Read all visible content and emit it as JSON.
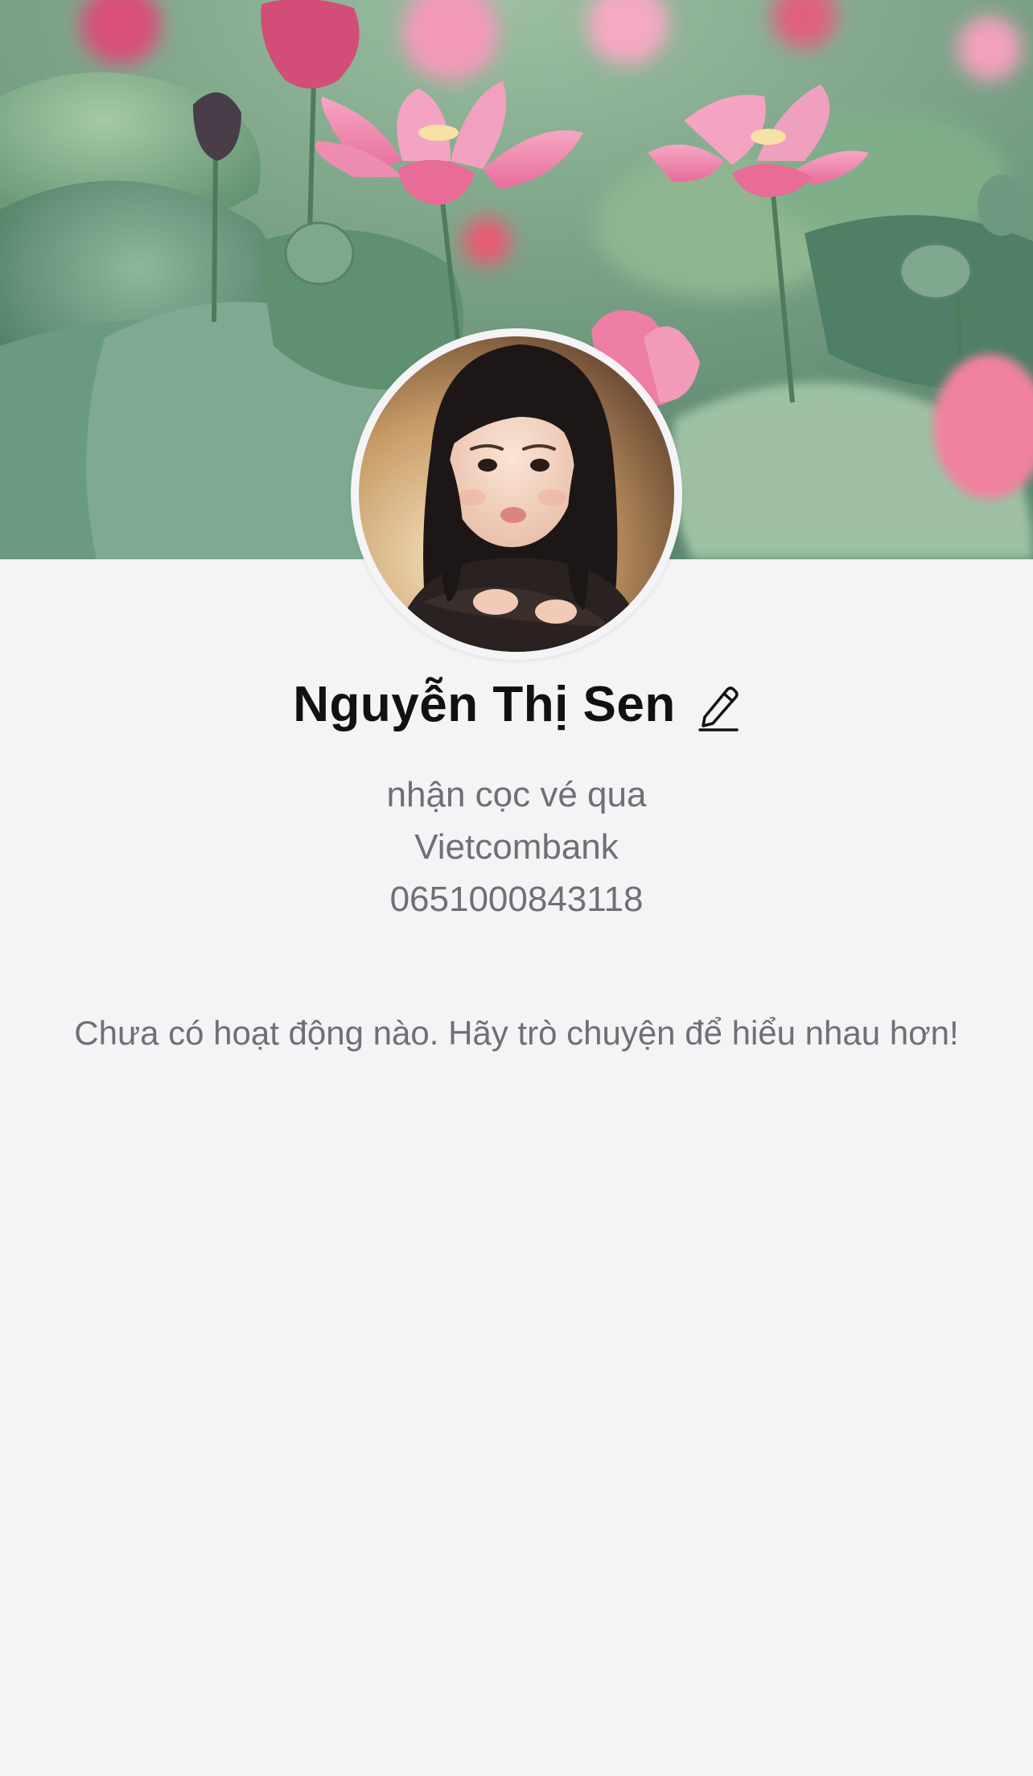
{
  "profile": {
    "name": "Nguyễn Thị Sen",
    "bio_lines": [
      "nhận cọc vé qua",
      "Vietcombank",
      "0651000843118"
    ],
    "edit_icon": "pencil-icon"
  },
  "activity": {
    "empty_message": "Chưa có hoạt động nào. Hãy trò chuyện để hiểu nhau hơn!"
  },
  "colors": {
    "background": "#f4f4f6",
    "name_text": "#111111",
    "secondary_text": "#6f6f74",
    "lotus_pink": "#f08bb0",
    "leaf_green": "#5f8f74"
  }
}
